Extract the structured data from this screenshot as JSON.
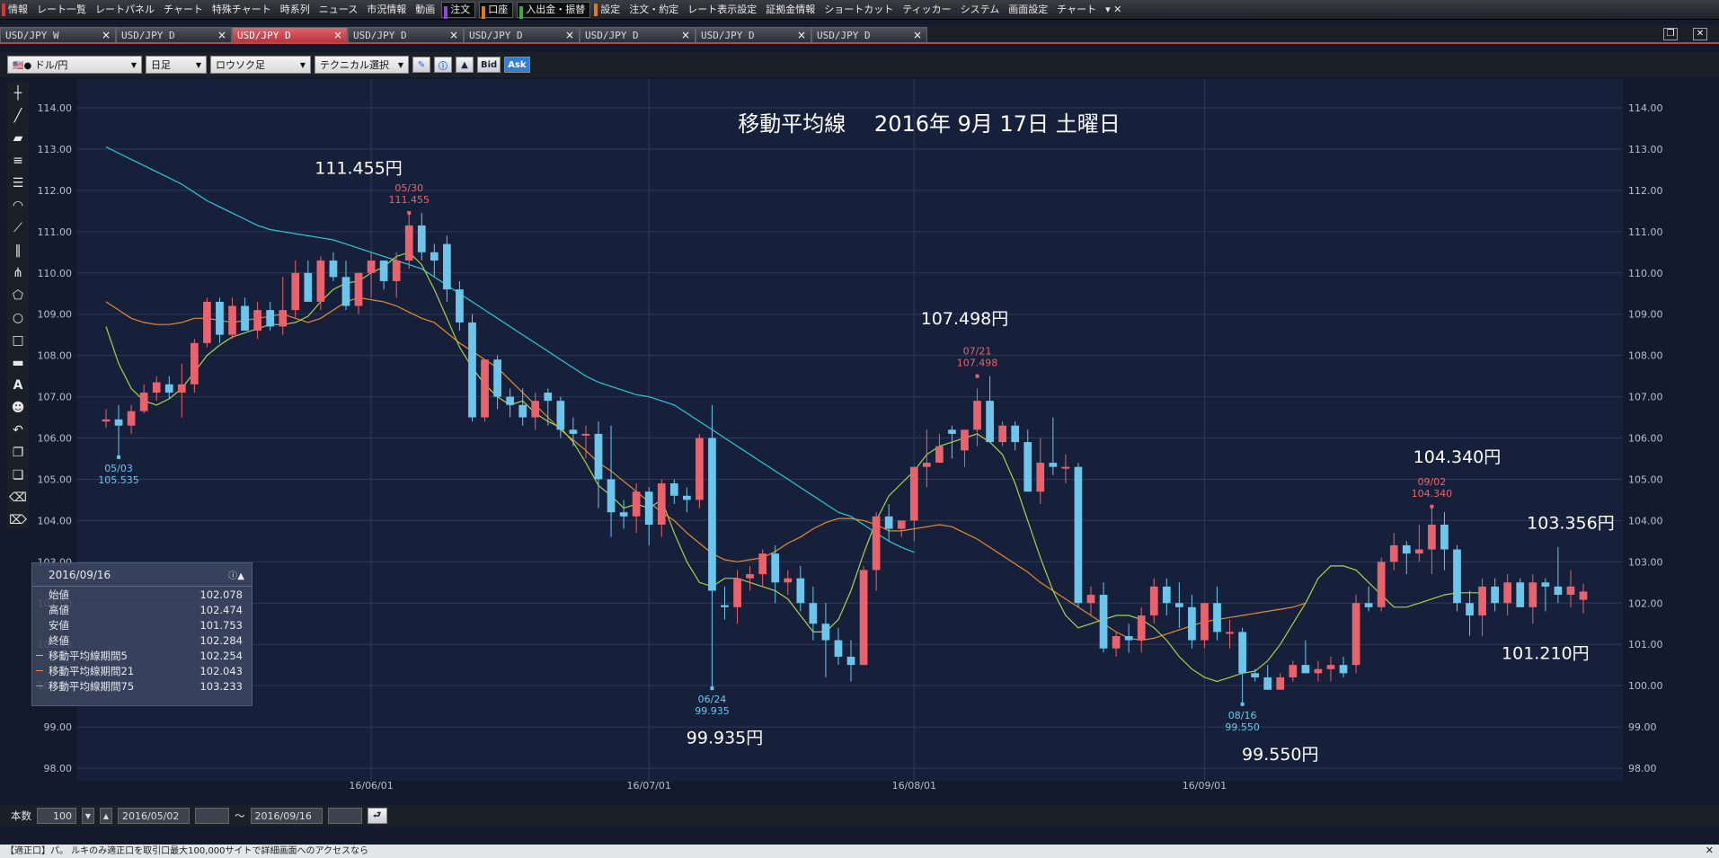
{
  "menu": [
    {
      "label": "情報",
      "accent": "#d33"
    },
    {
      "label": "レート一覧"
    },
    {
      "label": "レートパネル"
    },
    {
      "label": "チャート"
    },
    {
      "label": "特殊チャート"
    },
    {
      "label": "時系列"
    },
    {
      "label": "ニュース"
    },
    {
      "label": "市況情報"
    },
    {
      "label": "動画"
    },
    {
      "label": "注文",
      "accent": "#8a4cd0",
      "boxed": true
    },
    {
      "label": "口座",
      "accent": "#e07a1e",
      "boxed": true
    },
    {
      "label": "入出金・振替",
      "accent": "#3cae3c",
      "boxed": true
    },
    {
      "label": "設定",
      "accent": "#e07a1e"
    },
    {
      "label": "注文・約定"
    },
    {
      "label": "レート表示設定"
    },
    {
      "label": "証拠金情報"
    },
    {
      "label": "ショートカット"
    },
    {
      "label": "ティッカー"
    },
    {
      "label": "システム"
    },
    {
      "label": "画面設定"
    },
    {
      "label": "チャート"
    }
  ],
  "tabs": [
    "USD/JPY W",
    "USD/JPY D",
    "USD/JPY D",
    "USD/JPY D",
    "USD/JPY D",
    "USD/JPY D",
    "USD/JPY D",
    "USD/JPY D"
  ],
  "active_tab_index": 2,
  "toolbar": {
    "pair": "ドル/円",
    "timeframe": "日足",
    "candle": "ロウソク足",
    "technical": "テクニカル選択",
    "bid": "Bid",
    "ask": "Ask"
  },
  "info": {
    "date": "2016/09/16",
    "rows": [
      {
        "label": "始値",
        "value": "102.078"
      },
      {
        "label": "高値",
        "value": "102.474"
      },
      {
        "label": "安値",
        "value": "101.753"
      },
      {
        "label": "終値",
        "value": "102.284"
      },
      {
        "label": "移動平均線期間5",
        "value": "102.254",
        "color": "#a7d24a"
      },
      {
        "label": "移動平均線期間21",
        "value": "102.043",
        "color": "#e78a2e"
      },
      {
        "label": "移動平均線期間75",
        "value": "103.233",
        "color": "#2ec8d8"
      }
    ]
  },
  "footer": {
    "count_label": "本数",
    "count": "100",
    "start": "2016/05/02",
    "tilde": "～",
    "end": "2016/09/16"
  },
  "status_text": "【適正口】パ。 ルキのみ適正口を取引口最大100,000サイトで詳細画面へのアクセスなら",
  "chart_data": {
    "type": "candlestick",
    "title": "移動平均線　 2016年 9月 17日 土曜日",
    "ylim": [
      98.0,
      114.0
    ],
    "y_ticks": [
      "114.00",
      "113.00",
      "112.00",
      "111.00",
      "110.00",
      "109.00",
      "108.00",
      "107.00",
      "106.00",
      "105.00",
      "104.00",
      "103.00",
      "102.00",
      "101.00",
      "100.00",
      "99.00",
      "98.00"
    ],
    "x_ticks": [
      {
        "label": "16/06/01",
        "i": 21
      },
      {
        "label": "16/07/01",
        "i": 43
      },
      {
        "label": "16/08/01",
        "i": 64
      },
      {
        "label": "16/09/01",
        "i": 87
      }
    ],
    "colors": {
      "up": "#e8636b",
      "down": "#6cc6ec",
      "ma5": "#a7d24a",
      "ma21": "#e78a2e",
      "ma75": "#2ec8d8",
      "grid": "#2e3a55",
      "bg": "#131a2c"
    },
    "candles": [
      [
        106.4,
        106.7,
        106.25,
        106.45
      ],
      [
        106.45,
        106.8,
        105.53,
        106.3
      ],
      [
        106.3,
        106.8,
        106.1,
        106.65
      ],
      [
        106.65,
        107.3,
        106.6,
        107.1
      ],
      [
        107.1,
        107.5,
        106.9,
        107.35
      ],
      [
        107.3,
        107.5,
        106.95,
        107.1
      ],
      [
        107.1,
        107.8,
        106.5,
        107.3
      ],
      [
        107.3,
        108.4,
        107.1,
        108.3
      ],
      [
        108.3,
        109.4,
        108.2,
        109.3
      ],
      [
        109.3,
        109.4,
        108.3,
        108.5
      ],
      [
        108.5,
        109.4,
        108.4,
        109.2
      ],
      [
        109.2,
        109.4,
        108.6,
        108.6
      ],
      [
        108.6,
        109.3,
        108.4,
        109.1
      ],
      [
        109.1,
        109.3,
        108.6,
        108.7
      ],
      [
        108.7,
        109.9,
        108.5,
        109.1
      ],
      [
        109.1,
        110.3,
        108.9,
        110.0
      ],
      [
        110.0,
        110.3,
        109.3,
        109.3
      ],
      [
        109.3,
        110.4,
        109.1,
        110.3
      ],
      [
        110.3,
        110.5,
        109.8,
        109.9
      ],
      [
        109.9,
        110.3,
        109.1,
        109.2
      ],
      [
        109.2,
        110.0,
        109.0,
        110.0
      ],
      [
        110.0,
        110.5,
        109.4,
        110.3
      ],
      [
        110.3,
        110.3,
        109.6,
        109.8
      ],
      [
        109.8,
        110.5,
        109.4,
        110.3
      ],
      [
        110.3,
        111.45,
        110.1,
        111.15
      ],
      [
        111.15,
        111.45,
        110.3,
        110.5
      ],
      [
        110.5,
        110.7,
        109.9,
        110.3
      ],
      [
        110.7,
        110.9,
        109.3,
        109.6
      ],
      [
        109.6,
        109.8,
        108.6,
        108.8
      ],
      [
        108.8,
        109.0,
        106.4,
        106.5
      ],
      [
        106.5,
        107.9,
        106.4,
        107.9
      ],
      [
        107.9,
        108.0,
        106.7,
        107.0
      ],
      [
        107.0,
        107.2,
        106.5,
        106.8
      ],
      [
        106.8,
        107.2,
        106.3,
        106.5
      ],
      [
        106.5,
        107.1,
        106.2,
        106.9
      ],
      [
        107.1,
        107.2,
        106.3,
        106.9
      ],
      [
        106.9,
        107.0,
        106.0,
        106.2
      ],
      [
        106.2,
        106.5,
        105.8,
        106.1
      ],
      [
        106.1,
        106.3,
        105.5,
        106.1
      ],
      [
        106.1,
        106.4,
        104.3,
        105.0
      ],
      [
        105.0,
        106.3,
        103.6,
        104.2
      ],
      [
        104.2,
        104.5,
        103.8,
        104.1
      ],
      [
        104.1,
        104.9,
        103.7,
        104.7
      ],
      [
        104.7,
        104.8,
        103.4,
        103.9
      ],
      [
        103.9,
        105.0,
        103.6,
        104.9
      ],
      [
        104.9,
        105.0,
        104.4,
        104.6
      ],
      [
        104.6,
        104.8,
        104.2,
        104.5
      ],
      [
        104.5,
        106.1,
        104.3,
        106.0
      ],
      [
        106.0,
        106.8,
        99.93,
        102.3
      ],
      [
        101.95,
        102.4,
        101.6,
        101.9
      ],
      [
        101.9,
        102.8,
        101.5,
        102.6
      ],
      [
        102.6,
        102.9,
        102.3,
        102.7
      ],
      [
        102.7,
        103.3,
        102.4,
        103.2
      ],
      [
        103.2,
        103.4,
        102.0,
        102.5
      ],
      [
        102.5,
        102.8,
        102.2,
        102.6
      ],
      [
        102.6,
        102.9,
        101.8,
        102.0
      ],
      [
        102.0,
        102.4,
        101.1,
        101.5
      ],
      [
        101.5,
        102.0,
        100.2,
        101.1
      ],
      [
        101.1,
        101.4,
        100.5,
        100.7
      ],
      [
        100.7,
        101.1,
        100.1,
        100.5
      ],
      [
        100.5,
        102.9,
        100.5,
        102.8
      ],
      [
        102.8,
        104.2,
        102.3,
        104.1
      ],
      [
        104.1,
        104.4,
        103.5,
        103.8
      ],
      [
        103.8,
        104.0,
        103.6,
        104.0
      ],
      [
        104.0,
        105.3,
        103.5,
        105.3
      ],
      [
        105.3,
        106.2,
        104.8,
        105.4
      ],
      [
        105.4,
        106.1,
        105.5,
        105.8
      ],
      [
        106.2,
        106.3,
        105.5,
        106.1
      ],
      [
        105.7,
        106.2,
        105.3,
        106.2
      ],
      [
        106.2,
        107.2,
        105.8,
        106.9
      ],
      [
        106.9,
        107.5,
        105.9,
        105.9
      ],
      [
        105.9,
        106.4,
        105.8,
        106.3
      ],
      [
        106.3,
        106.4,
        105.7,
        105.9
      ],
      [
        105.9,
        106.2,
        104.9,
        104.7
      ],
      [
        104.7,
        106.0,
        104.4,
        105.4
      ],
      [
        105.4,
        106.5,
        105.1,
        105.3
      ],
      [
        105.3,
        105.6,
        104.9,
        105.3
      ],
      [
        105.3,
        105.4,
        101.9,
        102.0
      ],
      [
        102.0,
        102.4,
        101.7,
        102.2
      ],
      [
        102.2,
        102.5,
        100.8,
        100.9
      ],
      [
        100.9,
        101.3,
        100.7,
        101.2
      ],
      [
        101.2,
        101.5,
        100.8,
        101.1
      ],
      [
        101.1,
        101.9,
        100.8,
        101.7
      ],
      [
        101.7,
        102.6,
        101.5,
        102.4
      ],
      [
        102.4,
        102.6,
        101.7,
        102.0
      ],
      [
        102.0,
        102.5,
        101.4,
        101.9
      ],
      [
        101.9,
        102.2,
        100.9,
        101.1
      ],
      [
        101.1,
        102.0,
        100.9,
        102.0
      ],
      [
        102.0,
        102.4,
        101.1,
        101.3
      ],
      [
        101.3,
        101.6,
        100.9,
        101.3
      ],
      [
        101.3,
        101.4,
        99.55,
        100.3
      ],
      [
        100.3,
        100.4,
        100.1,
        100.2
      ],
      [
        100.2,
        100.5,
        99.9,
        99.9
      ],
      [
        99.9,
        100.3,
        99.9,
        100.2
      ],
      [
        100.2,
        100.6,
        100.1,
        100.5
      ],
      [
        100.5,
        101.1,
        100.4,
        100.3
      ],
      [
        100.3,
        100.6,
        100.1,
        100.4
      ],
      [
        100.4,
        100.7,
        100.1,
        100.5
      ],
      [
        100.5,
        100.7,
        100.2,
        100.3
      ],
      [
        100.5,
        102.2,
        100.3,
        102.0
      ],
      [
        102.0,
        102.4,
        101.8,
        101.9
      ],
      [
        101.9,
        103.1,
        101.8,
        103.0
      ],
      [
        103.0,
        103.7,
        102.8,
        103.4
      ],
      [
        103.4,
        103.5,
        102.7,
        103.2
      ],
      [
        103.2,
        103.9,
        103.0,
        103.3
      ],
      [
        103.3,
        104.34,
        102.7,
        103.9
      ],
      [
        103.9,
        104.2,
        102.8,
        103.3
      ],
      [
        103.3,
        103.4,
        101.8,
        102.0
      ],
      [
        102.0,
        102.3,
        101.21,
        101.7
      ],
      [
        101.7,
        102.6,
        101.2,
        102.4
      ],
      [
        102.4,
        102.6,
        101.8,
        102.0
      ],
      [
        102.0,
        102.7,
        101.7,
        102.5
      ],
      [
        102.5,
        102.6,
        101.9,
        101.9
      ],
      [
        101.9,
        102.7,
        101.5,
        102.5
      ],
      [
        102.5,
        102.6,
        101.8,
        102.4
      ],
      [
        102.4,
        103.36,
        102.0,
        102.2
      ],
      [
        102.2,
        102.8,
        101.9,
        102.4
      ],
      [
        102.08,
        102.47,
        101.75,
        102.28
      ]
    ],
    "ma5": [
      108.7,
      107.8,
      107.2,
      106.9,
      106.8,
      106.95,
      107.2,
      107.6,
      108.0,
      108.25,
      108.45,
      108.55,
      108.65,
      108.75,
      108.75,
      108.8,
      108.95,
      109.3,
      109.6,
      109.75,
      109.8,
      110.0,
      110.15,
      110.4,
      110.5,
      110.2,
      109.6,
      108.9,
      108.2,
      107.7,
      107.3,
      107.0,
      106.8,
      106.9,
      106.6,
      106.4,
      106.25,
      105.9,
      105.4,
      104.85,
      104.6,
      104.3,
      104.4,
      104.3,
      104.5,
      103.7,
      103.0,
      102.5,
      102.4,
      102.6,
      102.6,
      102.5,
      102.4,
      102.3,
      102.1,
      101.7,
      101.3,
      101.3,
      101.6,
      102.3,
      103.2,
      104.0,
      104.6,
      104.9,
      105.2,
      105.6,
      105.8,
      105.9,
      106.0,
      106.1,
      105.9,
      105.6,
      104.9,
      104.0,
      103.1,
      102.3,
      101.7,
      101.4,
      101.5,
      101.6,
      101.7,
      101.7,
      101.6,
      101.4,
      101.1,
      100.7,
      100.4,
      100.2,
      100.1,
      100.2,
      100.3,
      100.35,
      100.6,
      101.0,
      101.5,
      102.0,
      102.6,
      102.9,
      102.9,
      102.8,
      102.5,
      102.2,
      101.9,
      101.9,
      102.0,
      102.1,
      102.2,
      102.25,
      102.25,
      102.25
    ],
    "ma21": [
      109.3,
      109.1,
      108.9,
      108.8,
      108.75,
      108.75,
      108.8,
      108.9,
      108.9,
      108.85,
      108.8,
      108.85,
      108.9,
      108.95,
      109.0,
      108.9,
      108.8,
      108.9,
      109.1,
      109.3,
      109.4,
      109.35,
      109.3,
      109.2,
      109.05,
      108.9,
      108.8,
      108.55,
      108.3,
      108.1,
      107.9,
      107.7,
      107.4,
      107.1,
      106.8,
      106.5,
      106.2,
      105.95,
      105.7,
      105.4,
      105.2,
      104.95,
      104.7,
      104.45,
      104.2,
      104.0,
      103.7,
      103.45,
      103.2,
      103.05,
      103.0,
      103.05,
      103.1,
      103.25,
      103.45,
      103.6,
      103.8,
      103.95,
      104.05,
      104.05,
      104.0,
      103.9,
      103.75,
      103.75,
      103.8,
      103.85,
      103.9,
      103.85,
      103.7,
      103.55,
      103.35,
      103.15,
      102.95,
      102.75,
      102.5,
      102.3,
      102.1,
      101.9,
      101.7,
      101.5,
      101.3,
      101.15,
      101.1,
      101.15,
      101.25,
      101.35,
      101.45,
      101.55,
      101.6,
      101.65,
      101.7,
      101.75,
      101.8,
      101.85,
      101.9,
      102.0
    ],
    "ma75": [
      113.05,
      112.9,
      112.75,
      112.6,
      112.45,
      112.3,
      112.15,
      111.95,
      111.75,
      111.6,
      111.45,
      111.3,
      111.15,
      111.05,
      111.0,
      110.95,
      110.9,
      110.85,
      110.8,
      110.7,
      110.6,
      110.5,
      110.4,
      110.3,
      110.2,
      110.1,
      109.9,
      109.7,
      109.5,
      109.3,
      109.1,
      108.9,
      108.7,
      108.5,
      108.3,
      108.1,
      107.9,
      107.7,
      107.5,
      107.35,
      107.25,
      107.15,
      107.05,
      107.0,
      106.9,
      106.8,
      106.6,
      106.4,
      106.2,
      106.0,
      105.8,
      105.6,
      105.4,
      105.2,
      105.0,
      104.8,
      104.6,
      104.4,
      104.2,
      104.1,
      103.9,
      103.7,
      103.5,
      103.35,
      103.23
    ],
    "markers": [
      {
        "i": 1,
        "price": 105.535,
        "label": "05/03",
        "value": "105.535",
        "pos": "below",
        "color": "#6cc6ec"
      },
      {
        "i": 24,
        "price": 111.455,
        "label": "05/30",
        "value": "111.455",
        "pos": "above",
        "color": "#e8636b"
      },
      {
        "i": 48,
        "price": 99.935,
        "label": "06/24",
        "value": "99.935",
        "pos": "below",
        "color": "#6cc6ec"
      },
      {
        "i": 69,
        "price": 107.498,
        "label": "07/21",
        "value": "107.498",
        "pos": "above",
        "color": "#e8636b"
      },
      {
        "i": 90,
        "price": 99.55,
        "label": "08/16",
        "value": "99.550",
        "pos": "below",
        "color": "#6cc6ec"
      },
      {
        "i": 105,
        "price": 104.34,
        "label": "09/02",
        "value": "104.340",
        "pos": "above",
        "color": "#e8636b"
      }
    ],
    "annotations": [
      {
        "text": "111.455円",
        "i": 20,
        "price": 112.4
      },
      {
        "text": "107.498円",
        "i": 68,
        "price": 108.75
      },
      {
        "text": "99.935円",
        "i": 49,
        "price": 98.6
      },
      {
        "text": "99.550円",
        "i": 93,
        "price": 98.2
      },
      {
        "text": "104.340円",
        "i": 107,
        "price": 105.4
      },
      {
        "text": "103.356円",
        "i": 116,
        "price": 103.8
      },
      {
        "text": "101.210円",
        "i": 114,
        "price": 100.65
      }
    ]
  }
}
